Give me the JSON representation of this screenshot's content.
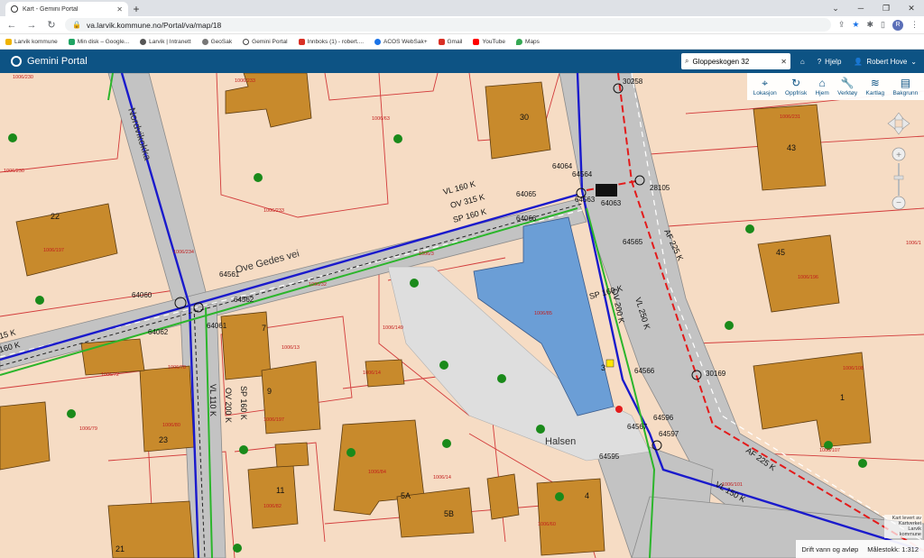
{
  "browser": {
    "tab_title": "Kart - Gemini Portal",
    "url": "va.larvik.kommune.no/Portal/va/map/18",
    "bookmarks": [
      {
        "label": "Larvik kommune",
        "color": "#f0b400"
      },
      {
        "label": "Min disk – Google...",
        "color": "#1fa463"
      },
      {
        "label": "Larvik | Intranett",
        "color": "#555"
      },
      {
        "label": "GeoSak",
        "color": "#777"
      },
      {
        "label": "Gemini Portal",
        "color": "#444"
      },
      {
        "label": "Innboks (1) - robert....",
        "color": "#d93025"
      },
      {
        "label": "ACOS WebSak+",
        "color": "#1a73e8"
      },
      {
        "label": "Gmail",
        "color": "#d93025"
      },
      {
        "label": "YouTube",
        "color": "#ff0000"
      },
      {
        "label": "Maps",
        "color": "#34a853"
      }
    ],
    "avatar_letter": "R"
  },
  "header": {
    "app_title": "Gemini Portal",
    "search_value": "Gloppeskogen 32",
    "home_label": "",
    "help_label": "Hjelp",
    "user_label": "Robert Hove"
  },
  "toolbar": {
    "items": [
      {
        "label": "Lokasjon",
        "icon": "crosshair-icon"
      },
      {
        "label": "Oppfrisk",
        "icon": "refresh-icon"
      },
      {
        "label": "Hjem",
        "icon": "home-icon"
      },
      {
        "label": "Verktøy",
        "icon": "wrench-icon"
      },
      {
        "label": "Kartlag",
        "icon": "layers-icon"
      },
      {
        "label": "Bakgrunn",
        "icon": "map-icon"
      }
    ]
  },
  "map": {
    "street_names": [
      "Nordvikokka",
      "Ove Gedes vei",
      "Halsen"
    ],
    "pipe_labels": [
      {
        "text": "VL 160 K"
      },
      {
        "text": "OV 315 K"
      },
      {
        "text": "SP 160 K"
      },
      {
        "text": "SP 160 K"
      },
      {
        "text": "OV 200 K"
      },
      {
        "text": "VL 250 K"
      },
      {
        "text": "AF 225 K"
      },
      {
        "text": "AF 225 K"
      },
      {
        "text": "VL 150 K"
      },
      {
        "text": "VL 110 K"
      },
      {
        "text": "OV 200 K"
      },
      {
        "text": "SP 160 K"
      },
      {
        "text": "15 K"
      },
      {
        "text": "160 K"
      }
    ],
    "node_ids": [
      "30258",
      "64064",
      "64564",
      "64065",
      "64563",
      "64063",
      "28105",
      "64066",
      "64565",
      "64561",
      "64060",
      "64562",
      "64061",
      "64062",
      "30169",
      "64566",
      "64596",
      "64567",
      "64597",
      "64595"
    ],
    "house_numbers": [
      "30",
      "43",
      "22",
      "45",
      "7",
      "9",
      "3",
      "1",
      "23",
      "11",
      "5A",
      "5B",
      "4",
      "21"
    ],
    "parcel_labels": [
      "1006/230",
      "1006/233",
      "1006/63",
      "1006/231",
      "1006/230",
      "1006/233",
      "1006/197",
      "1006/234",
      "1006/32",
      "1006/3",
      "1006/85",
      "1006/149",
      "1006/196",
      "1006/13",
      "1006/14",
      "1006/72",
      "1006/78",
      "1006/79",
      "1006/80",
      "1006/108",
      "1006/197",
      "1006/84",
      "1006/82",
      "1006/14",
      "1006/60",
      "1006/107",
      "1006/1",
      "1006/101"
    ]
  },
  "status": {
    "layer_label": "Drift vann og avløp",
    "scale_label": "Målestokk: 1:312",
    "attribution": "Kart levert av Kartverket Larvik kommune"
  },
  "colors": {
    "header_bg": "#0d5384",
    "parcel": "#f6dcc4",
    "road": "#bdbdbd",
    "building": "#c88a2c",
    "school": "#6b9ed6",
    "water_line": "#1a1acc",
    "sewer_line": "#2bb52b",
    "red_line": "#e31b1b"
  }
}
